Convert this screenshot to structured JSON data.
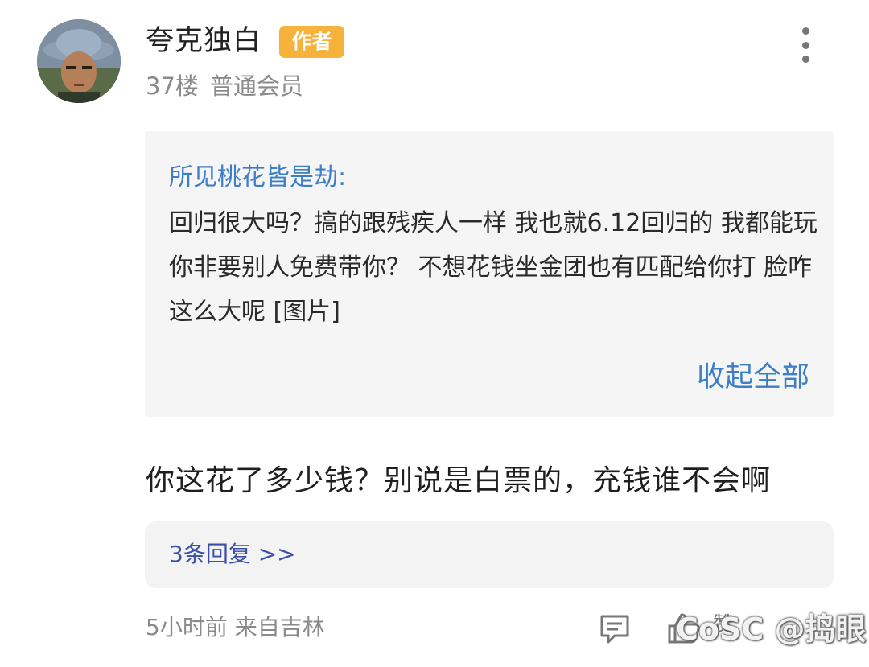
{
  "post": {
    "username": "夸克独白",
    "author_badge": "作者",
    "floor": "37楼",
    "member_level": "普通会员"
  },
  "quote": {
    "author": "所见桃花皆是劫:",
    "text": "回归很大吗？搞的跟残疾人一样 我也就6.12回归的 我都能玩 你非要别人免费带你？ 不想花钱坐金团也有匹配给你打 脸咋这么大呢 [图片]",
    "collapse_label": "收起全部"
  },
  "comment": {
    "text": "你这花了多少钱？别说是白票的，充钱谁不会啊"
  },
  "replies": {
    "label": "3条回复 >>"
  },
  "footer": {
    "time_location": "5小时前 来自吉林",
    "like_label": "赞"
  },
  "watermark": "CoSC @捣眼",
  "icons": {
    "more": "more-vertical-icon",
    "reply": "comment-icon",
    "like": "thumbs-up-icon"
  },
  "colors": {
    "badge": "#f7b23b",
    "link_blue": "#3d7fc7",
    "reply_link": "#3a4fa6",
    "meta_gray": "#8a8a8a"
  }
}
